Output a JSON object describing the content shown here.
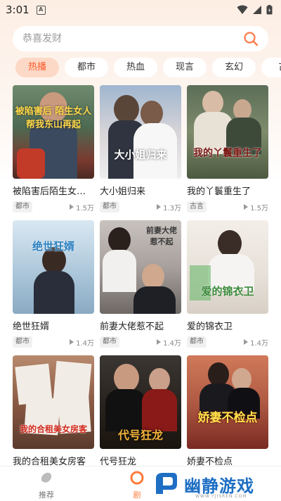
{
  "status_bar": {
    "time": "3:01",
    "notification_letter": "A"
  },
  "search": {
    "placeholder": "恭喜发财"
  },
  "tabs": [
    "热播",
    "都市",
    "热血",
    "现言",
    "玄幻",
    "古"
  ],
  "cards": [
    {
      "title": "被陷害后陌生女人帮我东山再起",
      "tag": "都市",
      "plays": "1.5万",
      "poster_text": "被陷害后 陌生女人帮我东山再起"
    },
    {
      "title": "大小姐归来",
      "tag": "都市",
      "plays": "1.3万",
      "poster_text": "大小姐归来"
    },
    {
      "title": "我的丫鬟重生了",
      "tag": "古言",
      "plays": "1.5万",
      "poster_text": "我的丫鬟重生了"
    },
    {
      "title": "绝世狂婿",
      "tag": "都市",
      "plays": "1.4万",
      "poster_text": "绝世狂婿"
    },
    {
      "title": "前妻大佬惹不起",
      "tag": "都市",
      "plays": "1.4万",
      "poster_text": "前妻大佬 惹不起"
    },
    {
      "title": "爱的锦衣卫",
      "tag": "都市",
      "plays": "1.4万",
      "poster_text": "爱的锦衣卫"
    },
    {
      "title": "我的合租美女房客",
      "tag": "",
      "plays": "",
      "poster_text": "我的合租美女房客"
    },
    {
      "title": "代号狂龙",
      "tag": "",
      "plays": "",
      "poster_text": "代号狂龙"
    },
    {
      "title": "娇妻不检点",
      "tag": "",
      "plays": "",
      "poster_text": "娇妻不检点"
    }
  ],
  "bottom_nav": {
    "recommend_label": "推荐",
    "second_label": "剧"
  },
  "watermark": {
    "name": "幽静游戏",
    "domain": "WWW.YJISREN.COM"
  },
  "colors": {
    "accent": "#ff5a2a",
    "tab_active_bg": "#fcd8c6",
    "watermark_blue": "#1e6fc4"
  }
}
